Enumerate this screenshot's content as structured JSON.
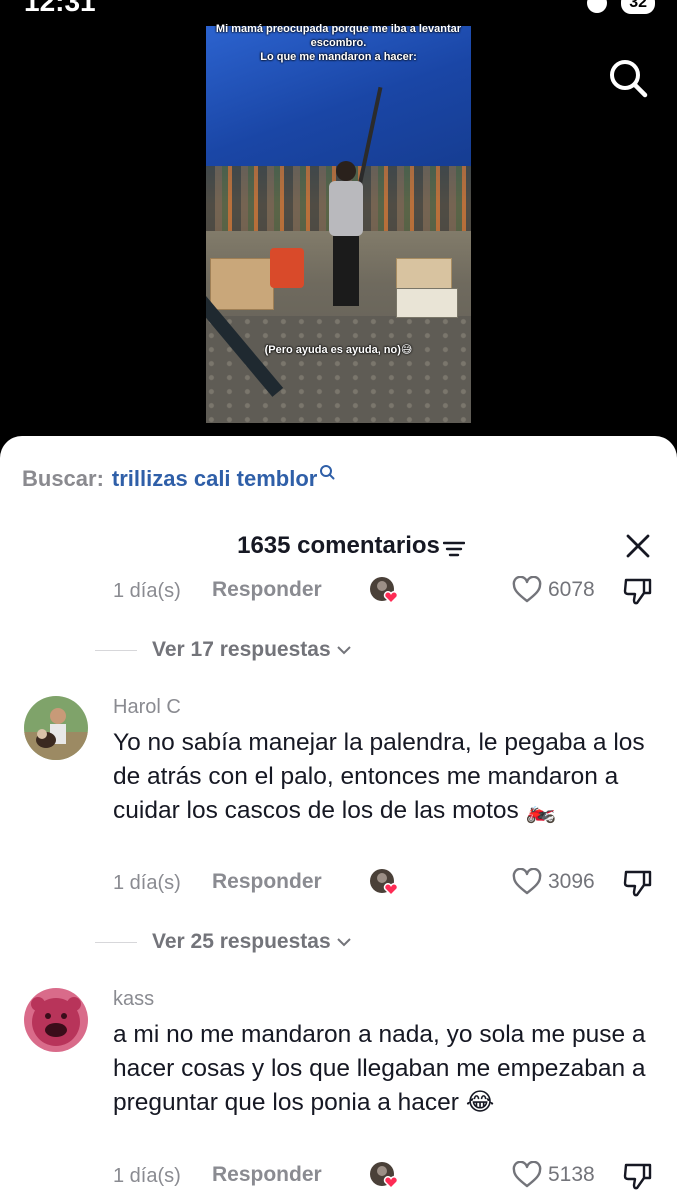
{
  "status_bar": {
    "time": "12:31",
    "battery": "32"
  },
  "video": {
    "caption_top": "Mi mamá preocupada porque me iba a levantar escombro.\nLo que me mandaron a hacer:",
    "caption_bottom": "(Pero ayuda es ayuda, no)😅"
  },
  "search_suggestion": {
    "label": "Buscar:",
    "term": "trillizas cali temblor"
  },
  "header": {
    "comment_count": "1635 comentarios"
  },
  "comments": [
    {
      "time": "1 día(s)",
      "reply_label": "Responder",
      "likes": "6078",
      "replies_label": "Ver 17 respuestas"
    },
    {
      "username": "Harol C",
      "text": "Yo no sabía manejar la palendra, le pegaba a los de atrás con el palo, entonces me mandaron a cuidar los cascos de los de las motos 🏍️",
      "time": "1 día(s)",
      "reply_label": "Responder",
      "likes": "3096",
      "replies_label": "Ver 25 respuestas"
    },
    {
      "username": "kass",
      "text": "a mi no me mandaron a nada, yo sola me puse a hacer cosas y los que llegaban me empezaban a preguntar que los ponia a hacer 😂",
      "time": "1 día(s)",
      "reply_label": "Responder",
      "likes": "5138"
    }
  ],
  "colors": {
    "link": "#2f5fa8",
    "muted": "#8a8b91",
    "text": "#161823",
    "heart": "#fe2c55"
  }
}
